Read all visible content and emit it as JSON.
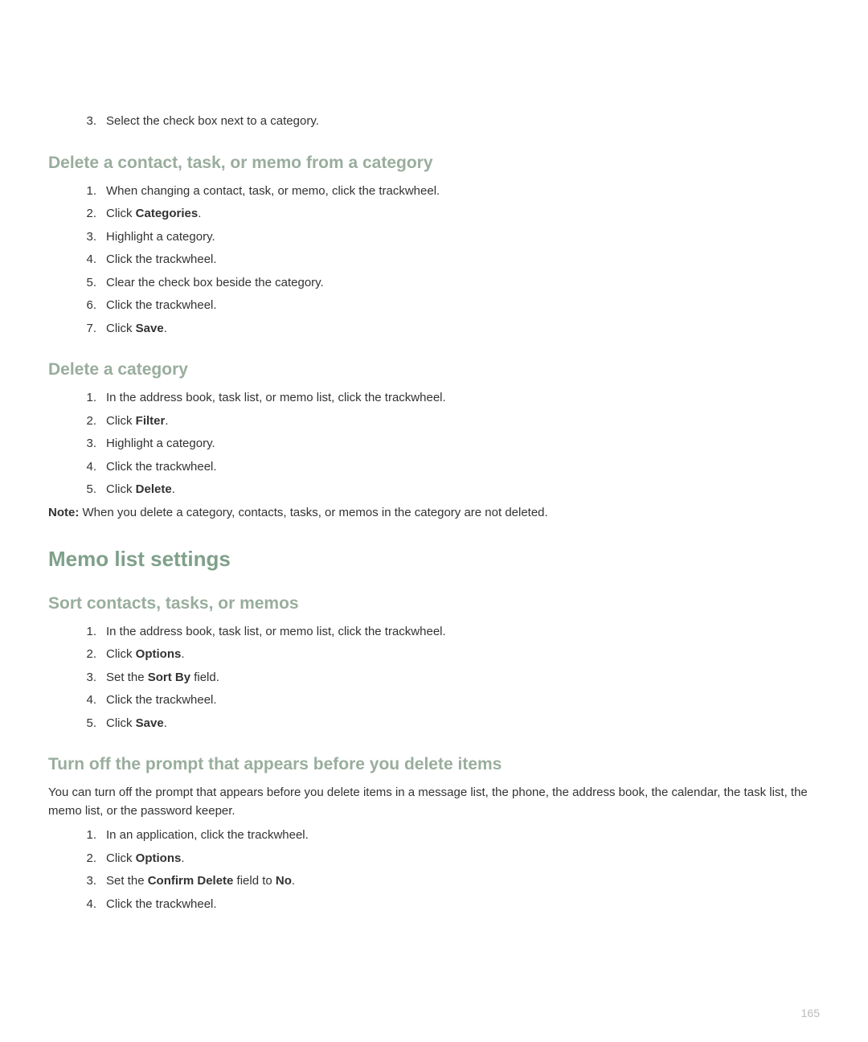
{
  "topStep": {
    "number": "3.",
    "text": "Select the check box next to a category."
  },
  "section1": {
    "heading": "Delete a contact, task, or memo from a category",
    "steps": [
      {
        "number": "1.",
        "text": "When changing a contact, task, or memo, click the trackwheel."
      },
      {
        "number": "2.",
        "prefix": "Click ",
        "bold": "Categories",
        "suffix": "."
      },
      {
        "number": "3.",
        "text": "Highlight a category."
      },
      {
        "number": "4.",
        "text": "Click the trackwheel."
      },
      {
        "number": "5.",
        "text": "Clear the check box beside the category."
      },
      {
        "number": "6.",
        "text": "Click the trackwheel."
      },
      {
        "number": "7.",
        "prefix": "Click ",
        "bold": "Save",
        "suffix": "."
      }
    ]
  },
  "section2": {
    "heading": "Delete a category",
    "steps": [
      {
        "number": "1.",
        "text": "In the address book, task list, or memo list, click the trackwheel."
      },
      {
        "number": "2.",
        "prefix": "Click ",
        "bold": "Filter",
        "suffix": "."
      },
      {
        "number": "3.",
        "text": "Highlight a category."
      },
      {
        "number": "4.",
        "text": "Click the trackwheel."
      },
      {
        "number": "5.",
        "prefix": "Click ",
        "bold": "Delete",
        "suffix": "."
      }
    ],
    "noteLabel": "Note:",
    "noteText": " When you delete a category, contacts, tasks, or memos in the category are not deleted."
  },
  "section3": {
    "heading": "Memo list settings"
  },
  "section4": {
    "heading": "Sort contacts, tasks, or memos",
    "steps": [
      {
        "number": "1.",
        "text": "In the address book, task list, or memo list, click the trackwheel."
      },
      {
        "number": "2.",
        "prefix": "Click ",
        "bold": "Options",
        "suffix": "."
      },
      {
        "number": "3.",
        "prefix": "Set the ",
        "bold": "Sort By",
        "suffix": " field."
      },
      {
        "number": "4.",
        "text": "Click the trackwheel."
      },
      {
        "number": "5.",
        "prefix": "Click ",
        "bold": "Save",
        "suffix": "."
      }
    ]
  },
  "section5": {
    "heading": "Turn off the prompt that appears before you delete items",
    "intro": "You can turn off the prompt that appears before you delete items in a message list, the phone, the address book, the calendar, the task list, the memo list, or the password keeper.",
    "steps": [
      {
        "number": "1.",
        "text": "In an application, click the trackwheel."
      },
      {
        "number": "2.",
        "prefix": "Click ",
        "bold": "Options",
        "suffix": "."
      },
      {
        "number": "3.",
        "prefix": "Set the ",
        "bold": "Confirm Delete",
        "suffix": " field to ",
        "bold2": "No",
        "suffix2": "."
      },
      {
        "number": "4.",
        "text": "Click the trackwheel."
      }
    ]
  },
  "pageNumber": "165"
}
